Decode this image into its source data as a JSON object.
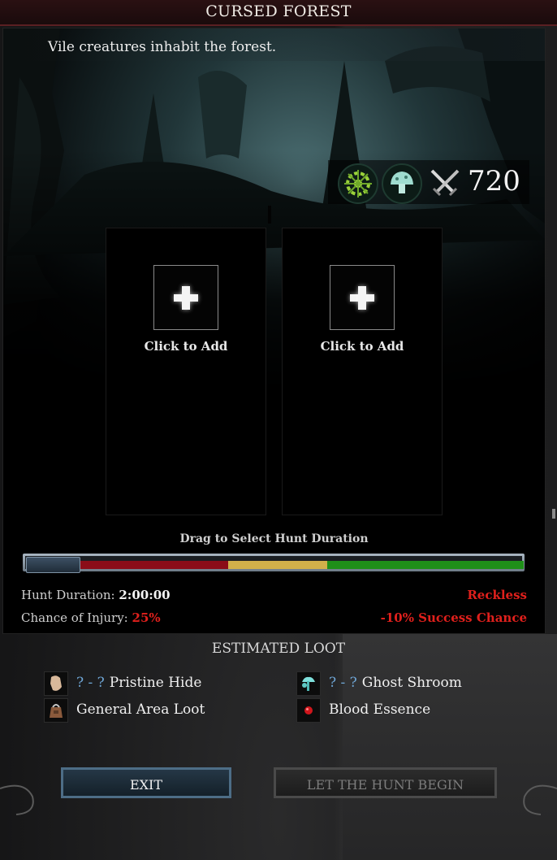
{
  "title": "CURSED FOREST",
  "description": "Vile creatures inhabit the forest.",
  "stats": {
    "power_value": "720",
    "icons": [
      "gear-rune-icon",
      "mushroom-icon",
      "crossed-swords-icon"
    ]
  },
  "slots": [
    {
      "label": "Click to Add",
      "icon": "plus-icon"
    },
    {
      "label": "Click to Add",
      "icon": "plus-icon"
    }
  ],
  "duration": {
    "drag_label": "Drag to Select Hunt Duration",
    "slider_fraction": 0,
    "hunt_duration_label": "Hunt Duration:",
    "hunt_duration_value": "2:00:00",
    "injury_label": "Chance of Injury:",
    "injury_value": "25%",
    "risk_label": "Reckless",
    "success_modifier": "-10% Success Chance",
    "colors": {
      "red": "#8b0d18",
      "yellow": "#d1b04a",
      "green": "#1f8f18"
    }
  },
  "loot": {
    "title": "ESTIMATED LOOT",
    "items": [
      {
        "qty": "? - ?",
        "name": "Pristine Hide",
        "icon": "hide-icon"
      },
      {
        "qty": "? - ?",
        "name": "Ghost Shroom",
        "icon": "ghost-shroom-icon"
      },
      {
        "qty": "",
        "name": "General Area Loot",
        "icon": "loot-bag-icon"
      },
      {
        "qty": "",
        "name": "Blood Essence",
        "icon": "blood-essence-icon"
      }
    ]
  },
  "buttons": {
    "exit": "EXIT",
    "begin": "LET THE HUNT BEGIN"
  },
  "colors": {
    "accent_red": "#e0201c",
    "quantity_blue": "#6fa6d6"
  }
}
